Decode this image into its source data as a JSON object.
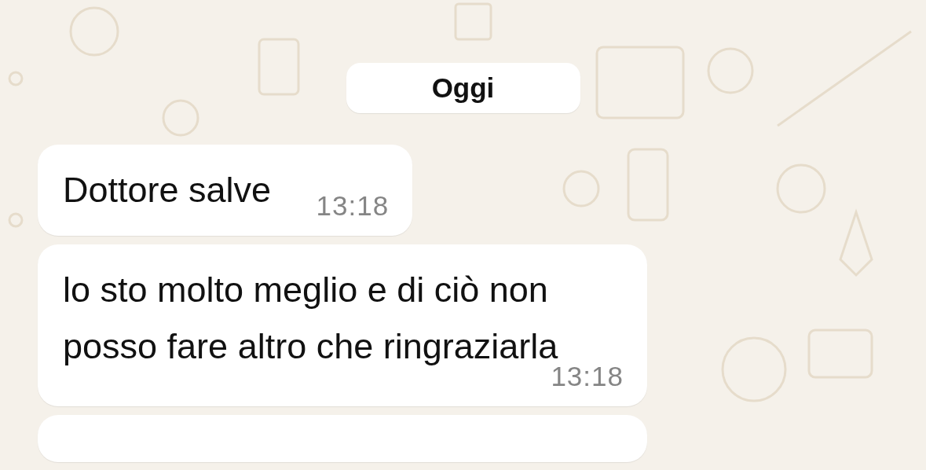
{
  "date_divider": "Oggi",
  "messages": [
    {
      "text": "Dottore salve",
      "time": "13:18"
    },
    {
      "text": "lo sto molto meglio e di ciò non posso fare altro che ringraziarla",
      "time": "13:18"
    }
  ]
}
